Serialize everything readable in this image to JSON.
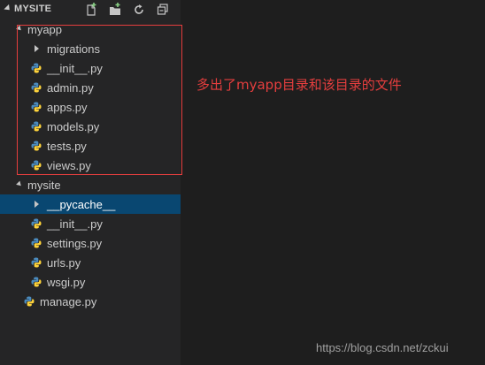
{
  "explorer": {
    "title": "MYSITE",
    "actions": [
      {
        "icon": "new-file-icon"
      },
      {
        "icon": "new-folder-icon"
      },
      {
        "icon": "refresh-icon"
      },
      {
        "icon": "collapse-all-icon"
      }
    ]
  },
  "tree": [
    {
      "label": "myapp",
      "kind": "folder",
      "state": "expanded"
    },
    {
      "label": "migrations",
      "kind": "folder",
      "state": "collapsed"
    },
    {
      "label": "__init__.py",
      "kind": "file"
    },
    {
      "label": "admin.py",
      "kind": "file"
    },
    {
      "label": "apps.py",
      "kind": "file"
    },
    {
      "label": "models.py",
      "kind": "file"
    },
    {
      "label": "tests.py",
      "kind": "file"
    },
    {
      "label": "views.py",
      "kind": "file"
    },
    {
      "label": "mysite",
      "kind": "folder",
      "state": "expanded"
    },
    {
      "label": "__pycache__",
      "kind": "folder",
      "state": "collapsed",
      "selected": true
    },
    {
      "label": "__init__.py",
      "kind": "file"
    },
    {
      "label": "settings.py",
      "kind": "file"
    },
    {
      "label": "urls.py",
      "kind": "file"
    },
    {
      "label": "wsgi.py",
      "kind": "file"
    },
    {
      "label": "manage.py",
      "kind": "file"
    }
  ],
  "annotation": {
    "text": "多出了myapp目录和该目录的文件",
    "color": "#e53e3e"
  },
  "watermark": "https://blog.csdn.net/zckui",
  "colors": {
    "sidebar_bg": "#252526",
    "editor_bg": "#1e1e1e",
    "selection_bg": "#094771",
    "text": "#cccccc",
    "python_blue": "#4b8bbe",
    "python_yellow": "#ffd43b"
  }
}
